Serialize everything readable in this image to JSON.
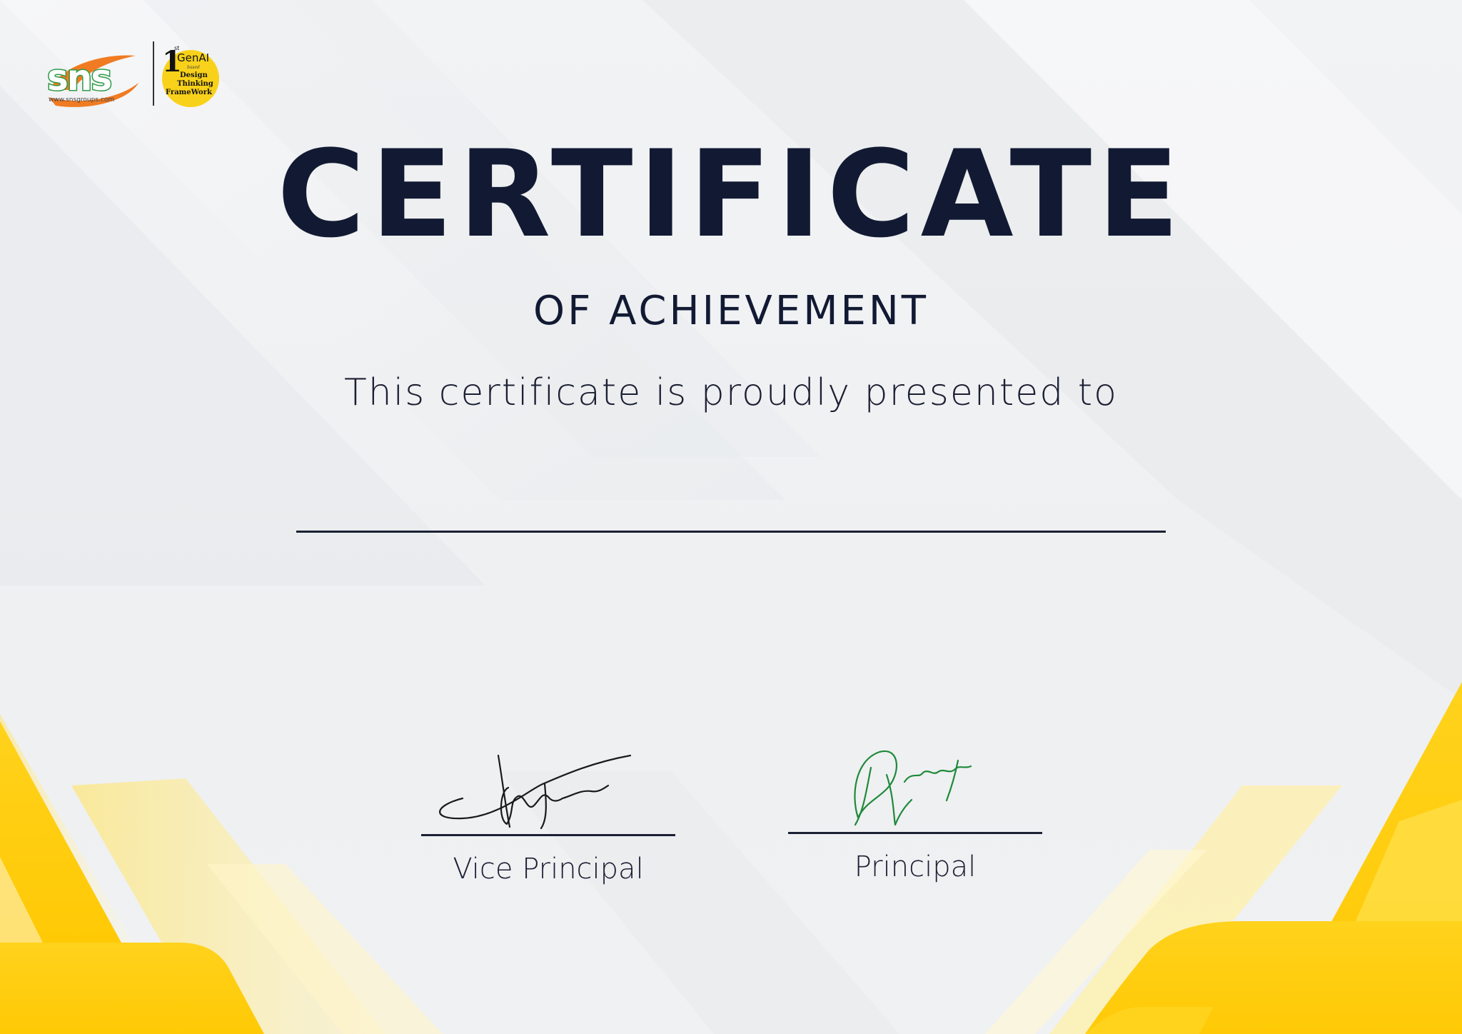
{
  "certificate": {
    "title": "CERTIFICATE",
    "subtitle": "OF ACHIEVEMENT",
    "presented_text": "This certificate is proudly presented to",
    "recipient_name": ""
  },
  "logo": {
    "brand": "sns",
    "website": "www.snsgroups.com",
    "badge_rank": "1",
    "badge_rank_suffix": "st",
    "badge_title": "GenAI",
    "badge_small": "based",
    "badge_lines": [
      "Design",
      "Thinking",
      "FrameWork"
    ]
  },
  "signatures": [
    {
      "label": "Vice Principal",
      "ink_color": "#1a1a1a"
    },
    {
      "label": "Principal",
      "ink_color": "#1f8a3b"
    }
  ],
  "colors": {
    "title": "#121a33",
    "accent_yellow": "#ffcb05",
    "logo_orange": "#f07b22",
    "logo_green": "#2e9a47",
    "badge_yellow": "#f8d21a"
  }
}
